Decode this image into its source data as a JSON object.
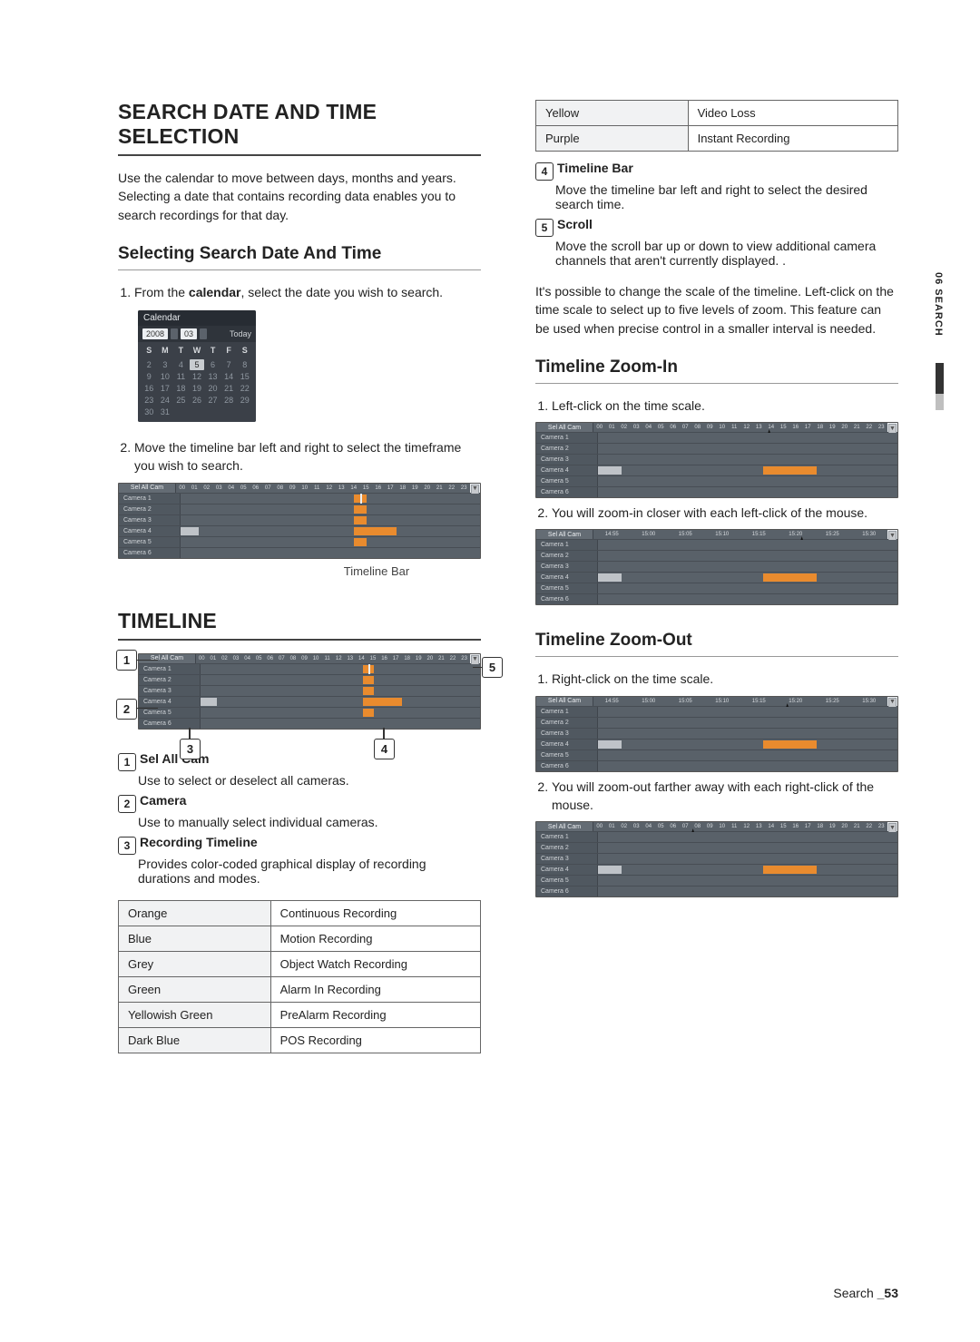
{
  "side_tab": "06 SEARCH",
  "footer": {
    "label": "Search",
    "page": "_53"
  },
  "left": {
    "h2a": "SEARCH DATE AND TIME",
    "h2b": "SELECTION",
    "intro": "Use the calendar to move between days, months and years. Selecting a date that contains recording data enables you to search recordings for that day.",
    "h3_select": "Selecting Search Date And Time",
    "step1_pre": "From the ",
    "step1_bold": "calendar",
    "step1_post": ", select the date you wish to search.",
    "cal": {
      "title": "Calendar",
      "year": "2008",
      "month": "03",
      "today": "Today",
      "dow": [
        "S",
        "M",
        "T",
        "W",
        "T",
        "F",
        "S"
      ],
      "weeks": [
        [
          "",
          "",
          "",
          "",
          "",
          "",
          ""
        ],
        [
          "2",
          "3",
          "4",
          "5",
          "6",
          "7",
          "8"
        ],
        [
          "9",
          "10",
          "11",
          "12",
          "13",
          "14",
          "15"
        ],
        [
          "16",
          "17",
          "18",
          "19",
          "20",
          "21",
          "22"
        ],
        [
          "23",
          "24",
          "25",
          "26",
          "27",
          "28",
          "29"
        ],
        [
          "30",
          "31",
          "",
          "",
          "",
          "",
          ""
        ]
      ],
      "selected": "5"
    },
    "step2": "Move the timeline bar left and right to select the timeframe you wish to search.",
    "tl_caption": "Timeline Bar",
    "h2_timeline": "TIMELINE",
    "timeline": {
      "sel_all": "Sel All Cam",
      "cams": [
        "Camera 1",
        "Camera 2",
        "Camera 3",
        "Camera 4",
        "Camera 5",
        "Camera 6"
      ],
      "hours": [
        "00",
        "01",
        "02",
        "03",
        "04",
        "05",
        "06",
        "07",
        "08",
        "09",
        "10",
        "11",
        "12",
        "13",
        "14",
        "15",
        "16",
        "17",
        "18",
        "19",
        "20",
        "21",
        "22",
        "23"
      ]
    },
    "defs": {
      "n1_t": "Sel All Cam",
      "n1_d": "Use to select or deselect all cameras.",
      "n2_t": "Camera",
      "n2_d": "Use to manually select individual cameras.",
      "n3_t": "Recording Timeline",
      "n3_d": "Provides color-coded graphical display of recording durations and modes."
    },
    "rec_table": [
      [
        "Orange",
        "Continuous Recording"
      ],
      [
        "Blue",
        "Motion Recording"
      ],
      [
        "Grey",
        "Object Watch Recording"
      ],
      [
        "Green",
        "Alarm In Recording"
      ],
      [
        "Yellowish Green",
        "PreAlarm Recording"
      ],
      [
        "Dark Blue",
        "POS Recording"
      ]
    ]
  },
  "right": {
    "rec_table2": [
      [
        "Yellow",
        "Video Loss"
      ],
      [
        "Purple",
        "Instant Recording"
      ]
    ],
    "n4_t": "Timeline Bar",
    "n4_d": "Move the timeline bar left and right to select the desired search time.",
    "n5_t": "Scroll",
    "n5_d": "Move the scroll bar up or down to view additional camera channels that aren't currently displayed. .",
    "zoom_note": "It's possible to change the scale of the timeline. Left-click on the time scale to select up to five levels of zoom. This feature can be used when precise control in a smaller interval is needed.",
    "h3_zoomin": "Timeline Zoom-In",
    "zi_step1": "Left-click on the time scale.",
    "zi_step2": "You will zoom-in closer with each left-click of the mouse.",
    "h3_zoomout": "Timeline Zoom-Out",
    "zo_step1": "Right-click on the time scale.",
    "zo_step2": "You will zoom-out farther away with each right-click of the mouse.",
    "mini_hours": [
      "00",
      "01",
      "02",
      "03",
      "04",
      "05",
      "06",
      "07",
      "08",
      "09",
      "10",
      "11",
      "12",
      "13",
      "14",
      "15",
      "16",
      "17",
      "18",
      "19",
      "20",
      "21",
      "22",
      "23"
    ],
    "mini_times": [
      "14:55",
      "15:00",
      "15:05",
      "15:10",
      "15:15",
      "15:20",
      "15:25",
      "15:30"
    ],
    "mini_cams": [
      "Camera 1",
      "Camera 2",
      "Camera 3",
      "Camera 4",
      "Camera 5",
      "Camera 6"
    ],
    "sel_all": "Sel All Cam"
  }
}
